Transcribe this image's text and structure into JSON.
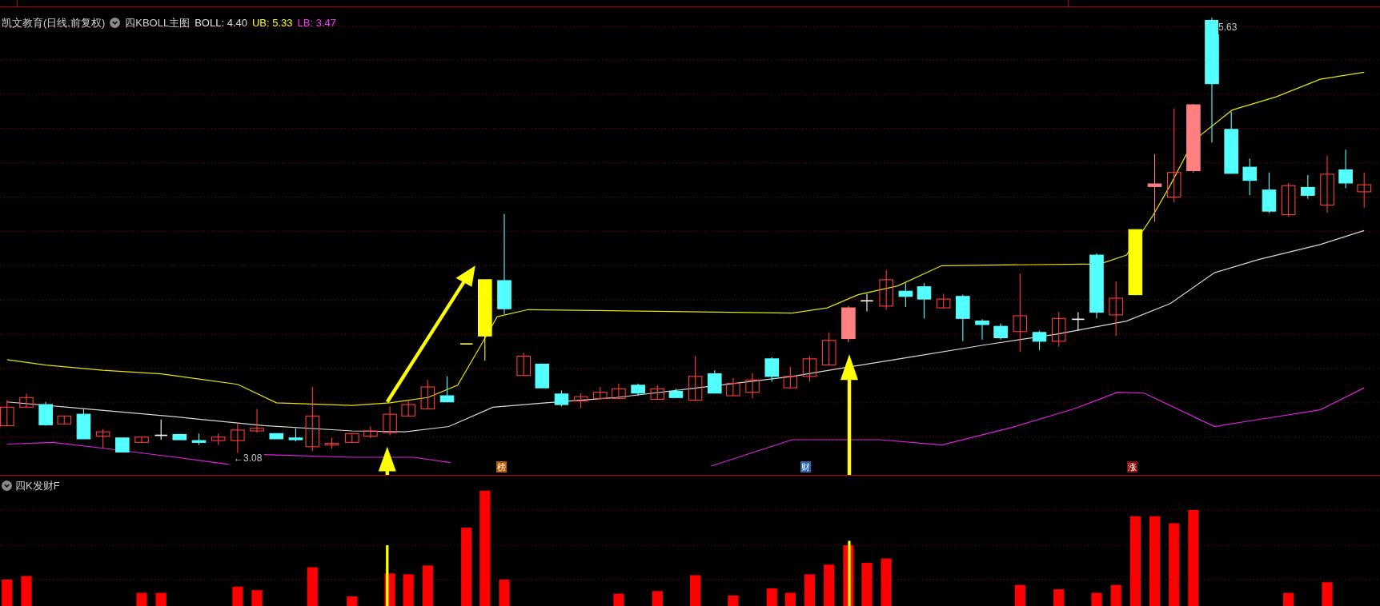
{
  "main_chart": {
    "title": "凯文教育(日线,前复权)",
    "indicator": "四KBOLL主图",
    "values": [
      {
        "label": "BOLL: 4.40",
        "color": "#e0e0e0"
      },
      {
        "label": "UB: 5.33",
        "color": "#ffff00"
      },
      {
        "label": "LB: 3.47",
        "color": "#ff33ff"
      }
    ],
    "price_labels": [
      "5.63",
      "←3.08"
    ],
    "markers": [
      {
        "text": "榜",
        "color": "#b85a00"
      },
      {
        "text": "财",
        "color": "#2f63b0"
      },
      {
        "text": "涨",
        "color": "#8a0a0a"
      }
    ]
  },
  "sub_chart": {
    "title": "四K发财F"
  }
}
